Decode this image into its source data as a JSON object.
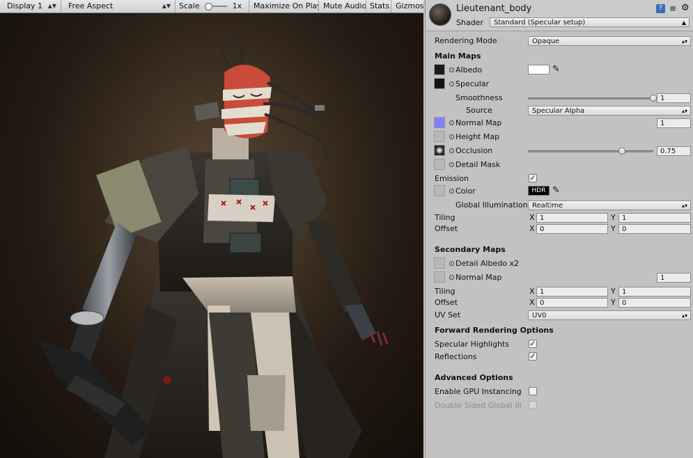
{
  "game_toolbar": {
    "display": "Display 1",
    "aspect": "Free Aspect",
    "scale_label": "Scale",
    "scale_value": "1x",
    "maximize": "Maximize On Play",
    "mute": "Mute Audio",
    "stats": "Stats",
    "gizmos": "Gizmos"
  },
  "inspector": {
    "material_name": "Lieutenant_body",
    "shader_label": "Shader",
    "shader_value": "Standard (Specular setup)",
    "rendering_mode_label": "Rendering Mode",
    "rendering_mode_value": "Opaque",
    "main_maps": {
      "header": "Main Maps",
      "albedo": "Albedo",
      "specular": "Specular",
      "smoothness_label": "Smoothness",
      "smoothness_value": "1",
      "smoothness_fraction": 1.0,
      "source_label": "Source",
      "source_value": "Specular Alpha",
      "normal_map": "Normal Map",
      "normal_value": "1",
      "height_map": "Height Map",
      "occlusion": "Occlusion",
      "occlusion_value": "0.75",
      "occlusion_fraction": 0.75,
      "detail_mask": "Detail Mask",
      "emission": "Emission",
      "emission_checked": true,
      "color": "Color",
      "hdr": "HDR",
      "gi_label": "Global Illumination",
      "gi_value": "Realtime",
      "tiling": "Tiling",
      "offset": "Offset",
      "x": "X",
      "y": "Y",
      "tiling_x": "1",
      "tiling_y": "1",
      "offset_x": "0",
      "offset_y": "0"
    },
    "secondary_maps": {
      "header": "Secondary Maps",
      "detail_albedo": "Detail Albedo x2",
      "normal_map": "Normal Map",
      "normal_value": "1",
      "tiling": "Tiling",
      "offset": "Offset",
      "x": "X",
      "y": "Y",
      "tiling_x": "1",
      "tiling_y": "1",
      "offset_x": "0",
      "offset_y": "0",
      "uv_set_label": "UV Set",
      "uv_set_value": "UV0"
    },
    "forward": {
      "header": "Forward Rendering Options",
      "specular_highlights": "Specular Highlights",
      "specular_checked": true,
      "reflections": "Reflections",
      "reflections_checked": true
    },
    "advanced": {
      "header": "Advanced Options",
      "gpu_instancing": "Enable GPU Instancing",
      "gpu_checked": false,
      "double_sided": "Double Sided Global Ill",
      "double_checked": false
    }
  },
  "colors": {
    "normal_swatch": "#8080ff",
    "albedo_color": "#ffffff",
    "panel_bg": "#c2c2c2"
  }
}
